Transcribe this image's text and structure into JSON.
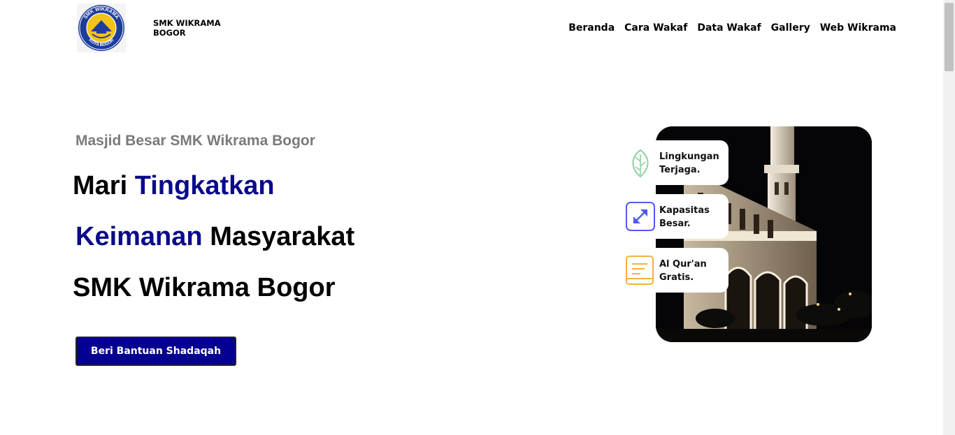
{
  "header": {
    "logo_text_top": "SMK WIKRAMA",
    "logo_text_bottom": "KOTA BOGOR",
    "brand_line1": "SMK WIKRAMA",
    "brand_line2": "BOGOR",
    "nav": [
      "Beranda",
      "Cara Wakaf",
      "Data Wakaf",
      "Gallery",
      "Web Wikrama"
    ]
  },
  "hero": {
    "subtitle": "Masjid Besar SMK Wikrama Bogor",
    "line1_a": "Mari",
    "line1_b": "Tingkatkan",
    "line2_a": "Keimanan",
    "line2_b": "Masyarakat",
    "line3": "SMK Wikrama Bogor",
    "cta_label": "Beri Bantuan Shadaqah"
  },
  "features": [
    {
      "icon": "leaf-icon",
      "text": "Lingkungan\nTerjaga.",
      "color": "#8fd19e"
    },
    {
      "icon": "expand-icon",
      "text": "Kapasitas\nBesar.",
      "color": "#4e5bf0"
    },
    {
      "icon": "book-icon",
      "text": "Al Qur'an\nGratis.",
      "color": "#f5b041"
    }
  ],
  "colors": {
    "accent": "#0b0a8a",
    "button": "#05008f",
    "subtitle": "#7a7a7a"
  }
}
